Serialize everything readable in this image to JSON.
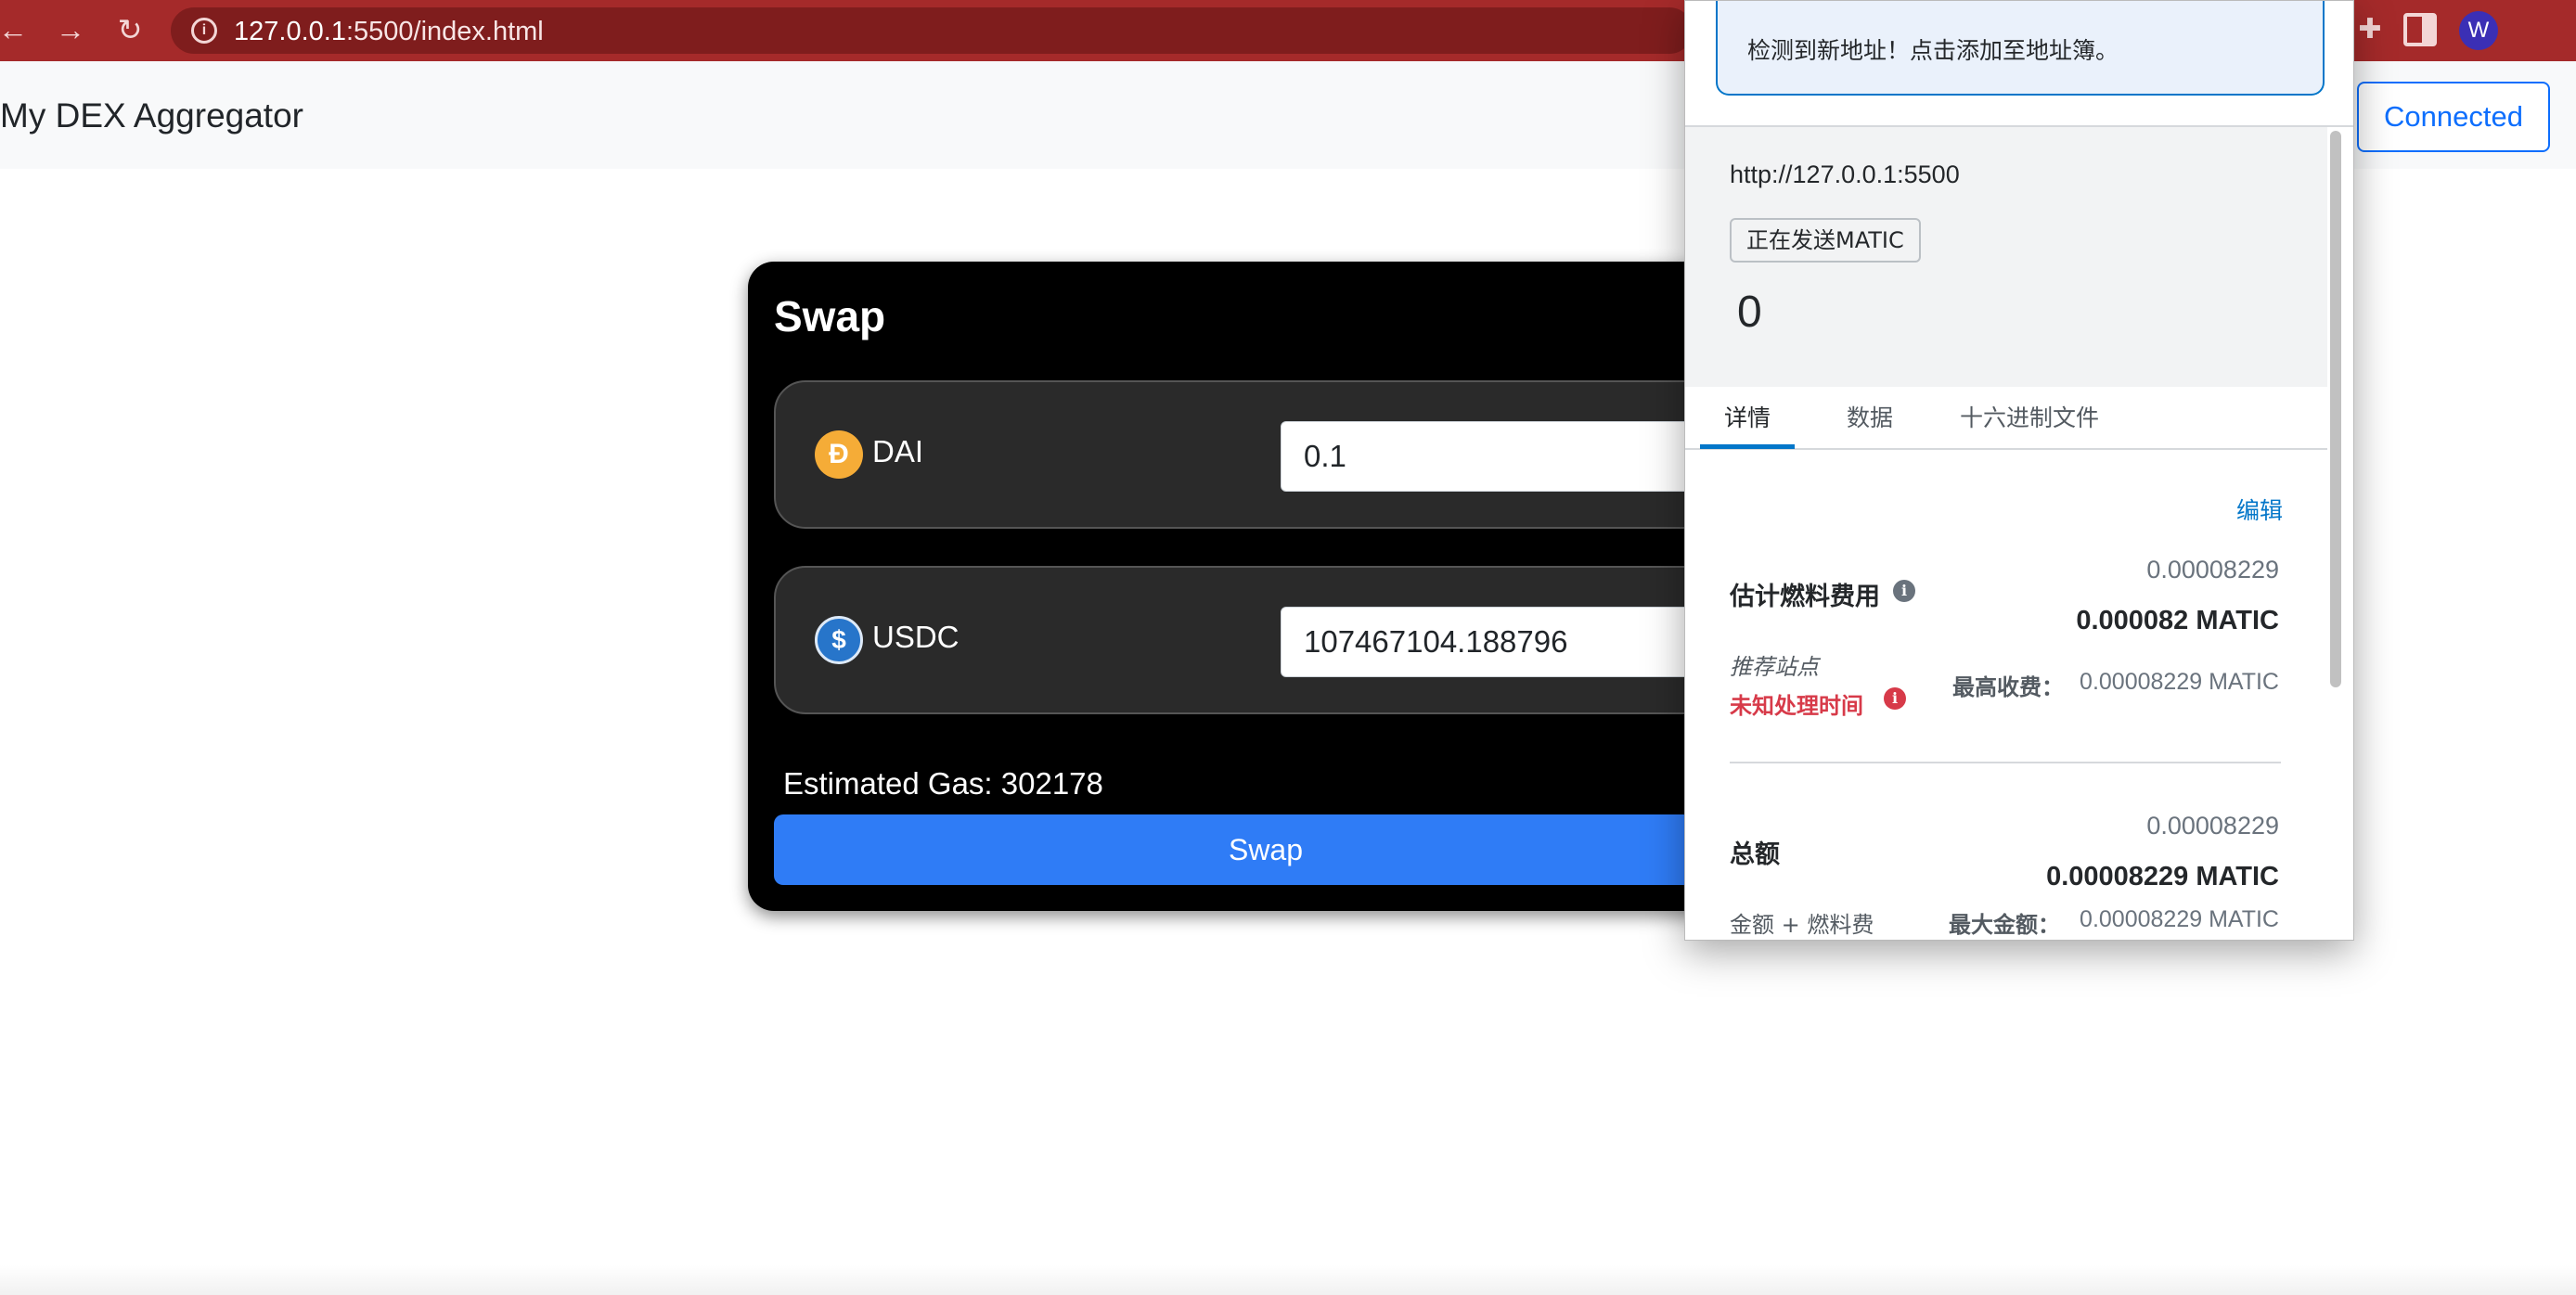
{
  "browser": {
    "url_host": "127.0.0.1",
    "url_path": ":5500/index.html",
    "nav_back": "←",
    "nav_forward": "→",
    "nav_reload": "↻",
    "info_glyph": "i",
    "ext_glyph": "✚",
    "profile_initial": "W",
    "theme_color": "#a52a2a"
  },
  "header": {
    "title": "My DEX Aggregator",
    "connect_label": "Connected"
  },
  "swap": {
    "title": "Swap",
    "from": {
      "symbol": "DAI",
      "amount": "0.1",
      "icon": "dai-token-icon"
    },
    "to": {
      "symbol": "USDC",
      "amount": "107467104.188796",
      "icon": "usdc-token-icon"
    },
    "gas_text": "Estimated Gas: 302178",
    "button_label": "Swap",
    "button_color": "#2f7cf6"
  },
  "wallet": {
    "notice": "检测到新地址！点击添加至地址簿。",
    "origin": "http://127.0.0.1:5500",
    "action": "正在发送MATIC",
    "amount": "0",
    "tabs": [
      {
        "label": "详情"
      },
      {
        "label": "数据"
      },
      {
        "label": "十六进制文件"
      }
    ],
    "edit_label": "编辑",
    "fee": {
      "label": "估计燃料费用",
      "value_small": "0.00008229",
      "value_bold": "0.000082 MATIC",
      "site_suggested": "推荐站点",
      "unknown_time": "未知处理时间",
      "max_fee_label": "最高收费：",
      "max_fee_value": "0.00008229 MATIC"
    },
    "total": {
      "label": "总额",
      "value_small": "0.00008229",
      "value_bold": "0.00008229 MATIC",
      "sub_label": "金额 + 燃料费",
      "max_amount_label": "最大金额：",
      "max_amount_value": "0.00008229 MATIC"
    },
    "info_glyph": "i",
    "accent_color": "#0376c9",
    "warning_color": "#d73a49"
  }
}
